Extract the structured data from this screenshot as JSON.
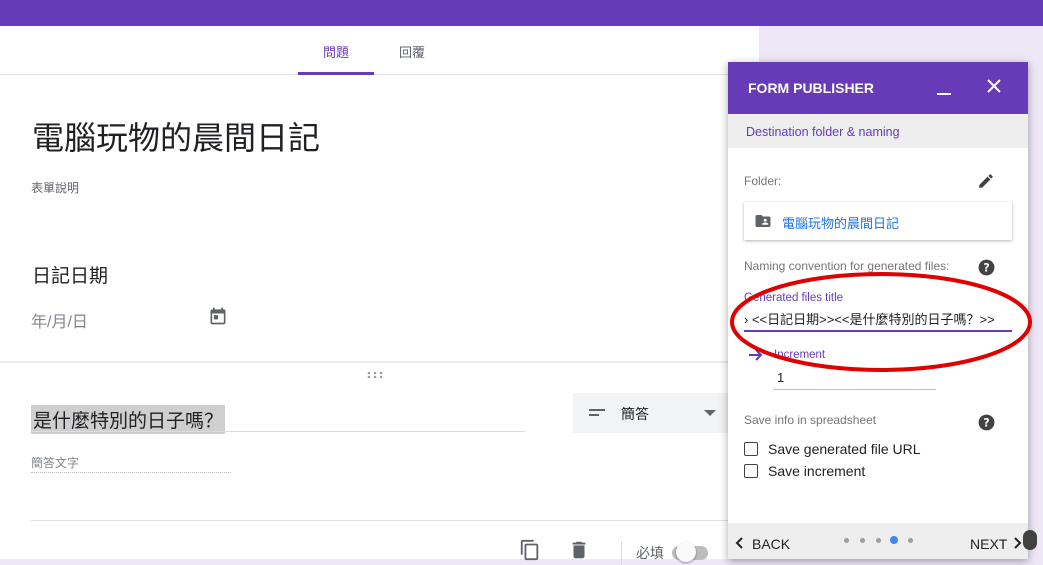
{
  "form_tabs": [
    {
      "label": "問題",
      "active": true
    },
    {
      "label": "回覆",
      "active": false
    }
  ],
  "form": {
    "title": "電腦玩物的晨間日記",
    "description_placeholder": "表單說明",
    "question1": {
      "title": "日記日期",
      "date_placeholder": "年/月/日"
    },
    "question2": {
      "title": "是什麼特別的日子嗎？",
      "type_label": "簡答",
      "answer_placeholder": "簡答文字",
      "required_label": "必填",
      "required_on": false
    }
  },
  "panel": {
    "title": "FORM PUBLISHER",
    "section": "Destination folder & naming",
    "folder_label": "Folder:",
    "folder_name": "電腦玩物的晨間日記",
    "naming_label": "Naming convention for generated files:",
    "generated_title_label": "Generated files title",
    "generated_title_value": "› <<日記日期>><<是什麼特別的日子嗎？>>",
    "increment_label": "Increment",
    "increment_value": "1",
    "spreadsheet_label": "Save info in spreadsheet",
    "checkbox_url": "Save generated file URL",
    "checkbox_increment": "Save increment",
    "back_label": "BACK",
    "next_label": "NEXT",
    "steps_total": 5,
    "current_step": 4
  },
  "colors": {
    "accent": "#673ab7",
    "link": "#1a73e8",
    "annotation": "#e00000"
  },
  "icons": [
    "calendar-icon",
    "drag-handle-icon",
    "short-text-icon",
    "dropdown-arrow-icon",
    "copy-icon",
    "delete-icon",
    "minimize-icon",
    "close-icon",
    "edit-icon",
    "folder-shared-icon",
    "help-icon",
    "arrow-right-icon",
    "chevron-left-icon",
    "chevron-right-icon"
  ]
}
